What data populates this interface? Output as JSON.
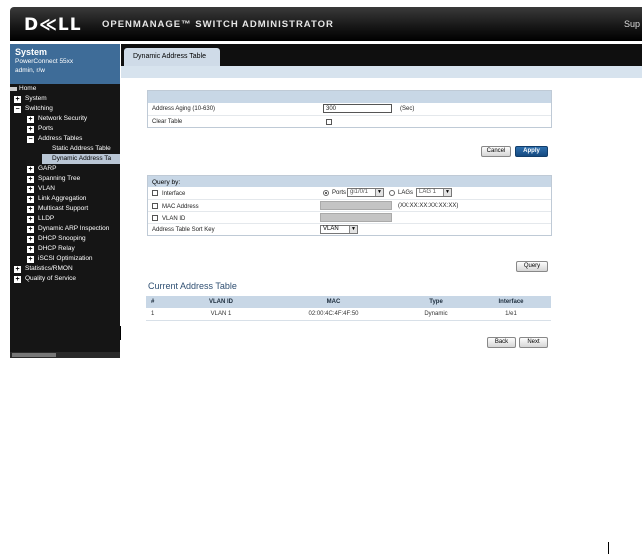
{
  "header": {
    "logo": "D≪LL",
    "app_title": "OPENMANAGE™ SWITCH ADMINISTRATOR",
    "support_link": "Sup"
  },
  "system": {
    "title": "System",
    "model": "PowerConnect 55xx",
    "user": "admin, r/w"
  },
  "tree": [
    {
      "label": "Home",
      "expander": "",
      "icon": "home-icon"
    },
    {
      "label": "System",
      "expander": "+"
    },
    {
      "label": "Switching",
      "expander": "−"
    },
    {
      "label": "Network Security",
      "expander": "+"
    },
    {
      "label": "Ports",
      "expander": "+"
    },
    {
      "label": "Address Tables",
      "expander": "−"
    },
    {
      "label": "Static Address Table",
      "expander": ""
    },
    {
      "label": "Dynamic Address Ta",
      "expander": ""
    },
    {
      "label": "GARP",
      "expander": "+"
    },
    {
      "label": "Spanning Tree",
      "expander": "+"
    },
    {
      "label": "VLAN",
      "expander": "+"
    },
    {
      "label": "Link Aggregation",
      "expander": "+"
    },
    {
      "label": "Multicast Support",
      "expander": "+"
    },
    {
      "label": "LLDP",
      "expander": "+"
    },
    {
      "label": "Dynamic ARP Inspection",
      "expander": "+"
    },
    {
      "label": "DHCP Snooping",
      "expander": "+"
    },
    {
      "label": "DHCP Relay",
      "expander": "+"
    },
    {
      "label": "iSCSI Optimization",
      "expander": "+"
    },
    {
      "label": "Statistics/RMON",
      "expander": "+"
    },
    {
      "label": "Quality of Service",
      "expander": "+"
    }
  ],
  "tab": {
    "label": "Dynamic Address Table"
  },
  "aging": {
    "label": "Address Aging (10-630)",
    "value": "300",
    "unit": "(Sec)",
    "clear_label": "Clear Table"
  },
  "buttons": {
    "cancel": "Cancel",
    "apply": "Apply",
    "query": "Query",
    "back": "Back",
    "next": "Next"
  },
  "query": {
    "title": "Query by:",
    "interface_label": "Interface",
    "ports_label": "Ports",
    "ports_value": "gi1/0/1",
    "lags_label": "LAGs",
    "lags_value": "LAG 1",
    "mac_label": "MAC Address",
    "mac_hint": "(XX:XX:XX:XX:XX:XX)",
    "vlan_label": "VLAN ID",
    "sort_label": "Address Table Sort Key",
    "sort_value": "VLAN"
  },
  "current": {
    "title": "Current Address Table",
    "columns": [
      "#",
      "VLAN ID",
      "MAC",
      "Type",
      "Interface"
    ],
    "rows": [
      [
        "1",
        "VLAN 1",
        "02:00:4C:4F:4F:50",
        "Dynamic",
        "1/e1"
      ]
    ]
  }
}
